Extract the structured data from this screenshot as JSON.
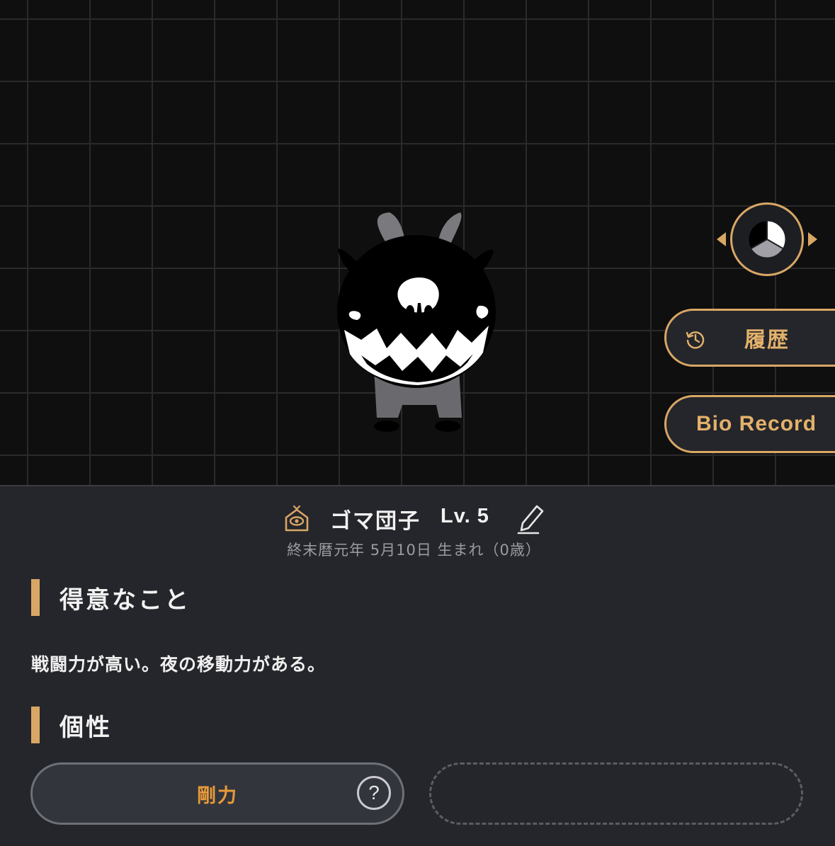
{
  "viewer": {
    "character": "goat-monster",
    "colors": {
      "accent": "#d9a765",
      "background": "#0f0f10",
      "grid": "#2a2a2c",
      "panel": "#25262b"
    }
  },
  "side_buttons": {
    "view_toggle_icon": "pie-view-icon",
    "history_icon": "history-icon",
    "history_label": "履歴",
    "bio_label": "Bio Record"
  },
  "profile": {
    "home_icon": "home-icon",
    "name": "ゴマ団子",
    "level": "Lv. 5",
    "edit_icon": "pencil-icon",
    "birth": "終末暦元年 5月10日 生まれ（0歳）"
  },
  "sections": {
    "skill_title": "得意なこと",
    "skill_text": "戦闘力が高い。夜の移動力がある。",
    "trait_title": "個性"
  },
  "traits": {
    "slot1_label": "剛力",
    "help_symbol": "?",
    "slot2_label": ""
  }
}
